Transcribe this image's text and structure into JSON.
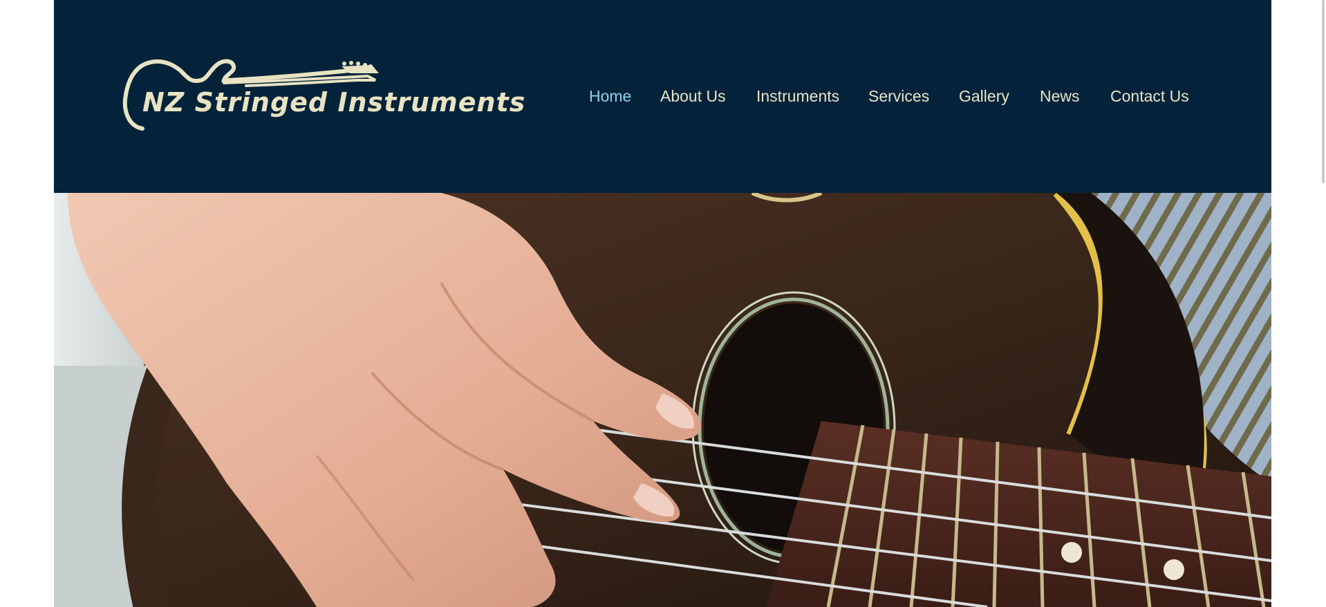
{
  "site": {
    "logo_text": "NZ Stringed Instruments"
  },
  "nav": {
    "items": [
      {
        "label": "Home",
        "active": true
      },
      {
        "label": "About Us",
        "active": false
      },
      {
        "label": "Instruments",
        "active": false
      },
      {
        "label": "Services",
        "active": false
      },
      {
        "label": "Gallery",
        "active": false
      },
      {
        "label": "News",
        "active": false
      },
      {
        "label": "Contact Us",
        "active": false
      }
    ]
  },
  "colors": {
    "header_bg": "#04233a",
    "nav_text": "#e9e4c7",
    "nav_active": "#8fd0ec",
    "logo": "#e8e3c3"
  },
  "hero": {
    "image": "ukulele-hand-strumming"
  }
}
